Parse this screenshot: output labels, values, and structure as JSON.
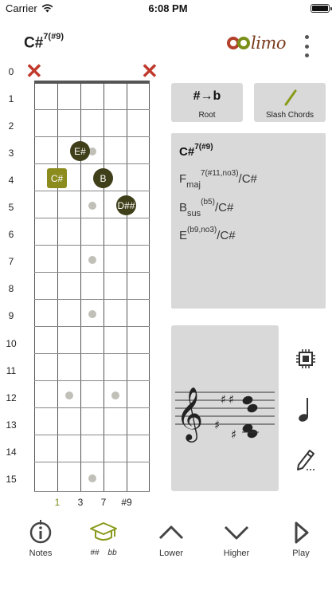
{
  "status_bar": {
    "carrier": "Carrier",
    "time": "6:08 PM"
  },
  "header": {
    "chord_root": "C#",
    "chord_superscript": "7(#9)",
    "logo_text": "limo"
  },
  "fretboard": {
    "fret_numbers": [
      "0",
      "1",
      "2",
      "3",
      "4",
      "5",
      "6",
      "7",
      "8",
      "9",
      "10",
      "11",
      "12",
      "13",
      "14",
      "15"
    ],
    "muted_strings": [
      "6",
      "1"
    ],
    "string_intervals": [
      "1",
      "3",
      "7",
      "#9"
    ],
    "notes": [
      {
        "label": "E#",
        "string": 3,
        "fret": 3
      },
      {
        "label": "C#",
        "string": 2,
        "fret": 4,
        "root": true
      },
      {
        "label": "B",
        "string": 4,
        "fret": 4
      },
      {
        "label": "D##",
        "string": 5,
        "fret": 5
      }
    ],
    "inlay_frets": [
      3,
      5,
      7,
      9,
      12,
      15
    ]
  },
  "tools": {
    "root": {
      "label": "Root",
      "icon": "sharp-to-flat-icon",
      "icon_text": "#→b"
    },
    "slash": {
      "label": "Slash Chords",
      "icon": "slash-icon"
    }
  },
  "chord_names": {
    "main_root": "C#",
    "main_sup": "7(#9)",
    "alternatives": [
      {
        "root": "F",
        "sub": "maj",
        "sup": "7(#11,no3)",
        "bass": "/C#"
      },
      {
        "root": "B",
        "sub": "sus",
        "sup": "(b5)",
        "bass": "/C#"
      },
      {
        "root": "E",
        "sub": "",
        "sup": "(b9,no3)",
        "bass": "/C#"
      }
    ]
  },
  "side_tools": [
    "chip-icon",
    "quarter-note-icon",
    "pencil-icon"
  ],
  "bottom_nav": {
    "notes": {
      "label": "Notes",
      "icon": "info-icon"
    },
    "accidentals": {
      "label": "##    bb",
      "icon": "graduation-cap-icon"
    },
    "lower": {
      "label": "Lower",
      "icon": "chevron-up-icon"
    },
    "higher": {
      "label": "Higher",
      "icon": "chevron-down-icon"
    },
    "play": {
      "label": "Play",
      "icon": "play-icon"
    }
  },
  "colors": {
    "note_dark": "#3f3f1a",
    "note_root": "#8b8b1e",
    "mute_red": "#c0392b",
    "panel_gray": "#d9d9d9",
    "accent_olive": "#8a9a1a"
  }
}
